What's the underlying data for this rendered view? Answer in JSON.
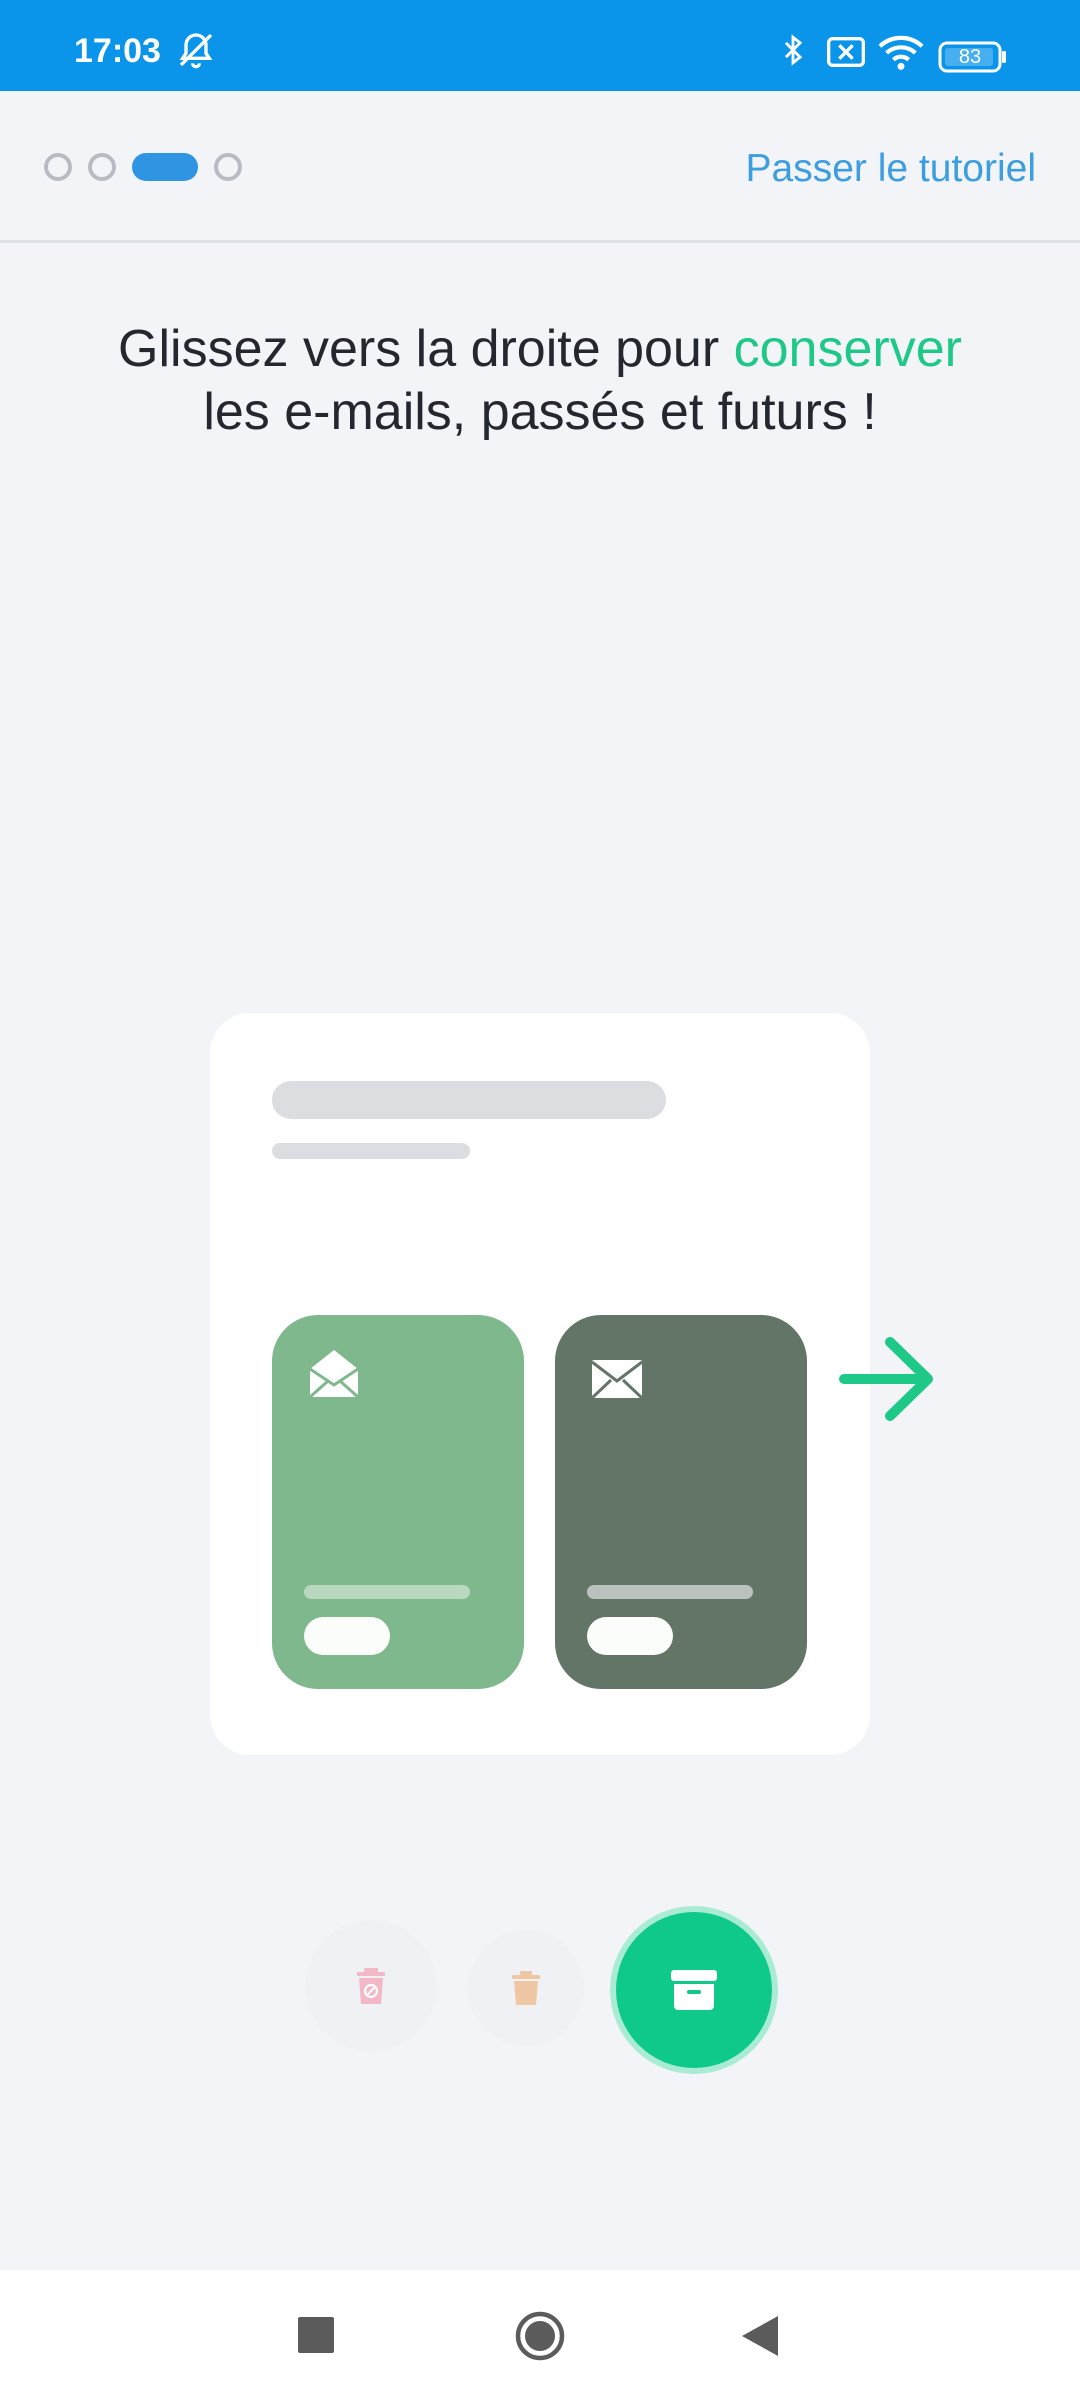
{
  "status_bar": {
    "time": "17:03",
    "battery": "83",
    "icons": [
      "bell-off-icon",
      "bluetooth-icon",
      "sim-x-icon",
      "wifi-icon",
      "battery-icon"
    ]
  },
  "header": {
    "pagination": {
      "total": 4,
      "active_index": 2
    },
    "skip_label": "Passer le tutoriel"
  },
  "headline": {
    "part1": "Glissez vers la droite pour ",
    "accent": "conserver",
    "part2": "les e-mails, passés et futurs !"
  },
  "illustration": {
    "icons": [
      "envelope-open-icon",
      "envelope-closed-icon",
      "arrow-right-icon"
    ]
  },
  "actions": [
    {
      "name": "block-delete",
      "icon": "trash-block-icon"
    },
    {
      "name": "delete",
      "icon": "trash-icon"
    },
    {
      "name": "keep",
      "icon": "archive-icon"
    }
  ],
  "colors": {
    "status_bar": "#0a95ea",
    "accent_green": "#1ec887",
    "link_blue": "#3c9ee0",
    "card_green_light": "#80b88e",
    "card_green_dark": "#627567"
  },
  "navbar": {
    "buttons": [
      "recents",
      "home",
      "back"
    ]
  }
}
